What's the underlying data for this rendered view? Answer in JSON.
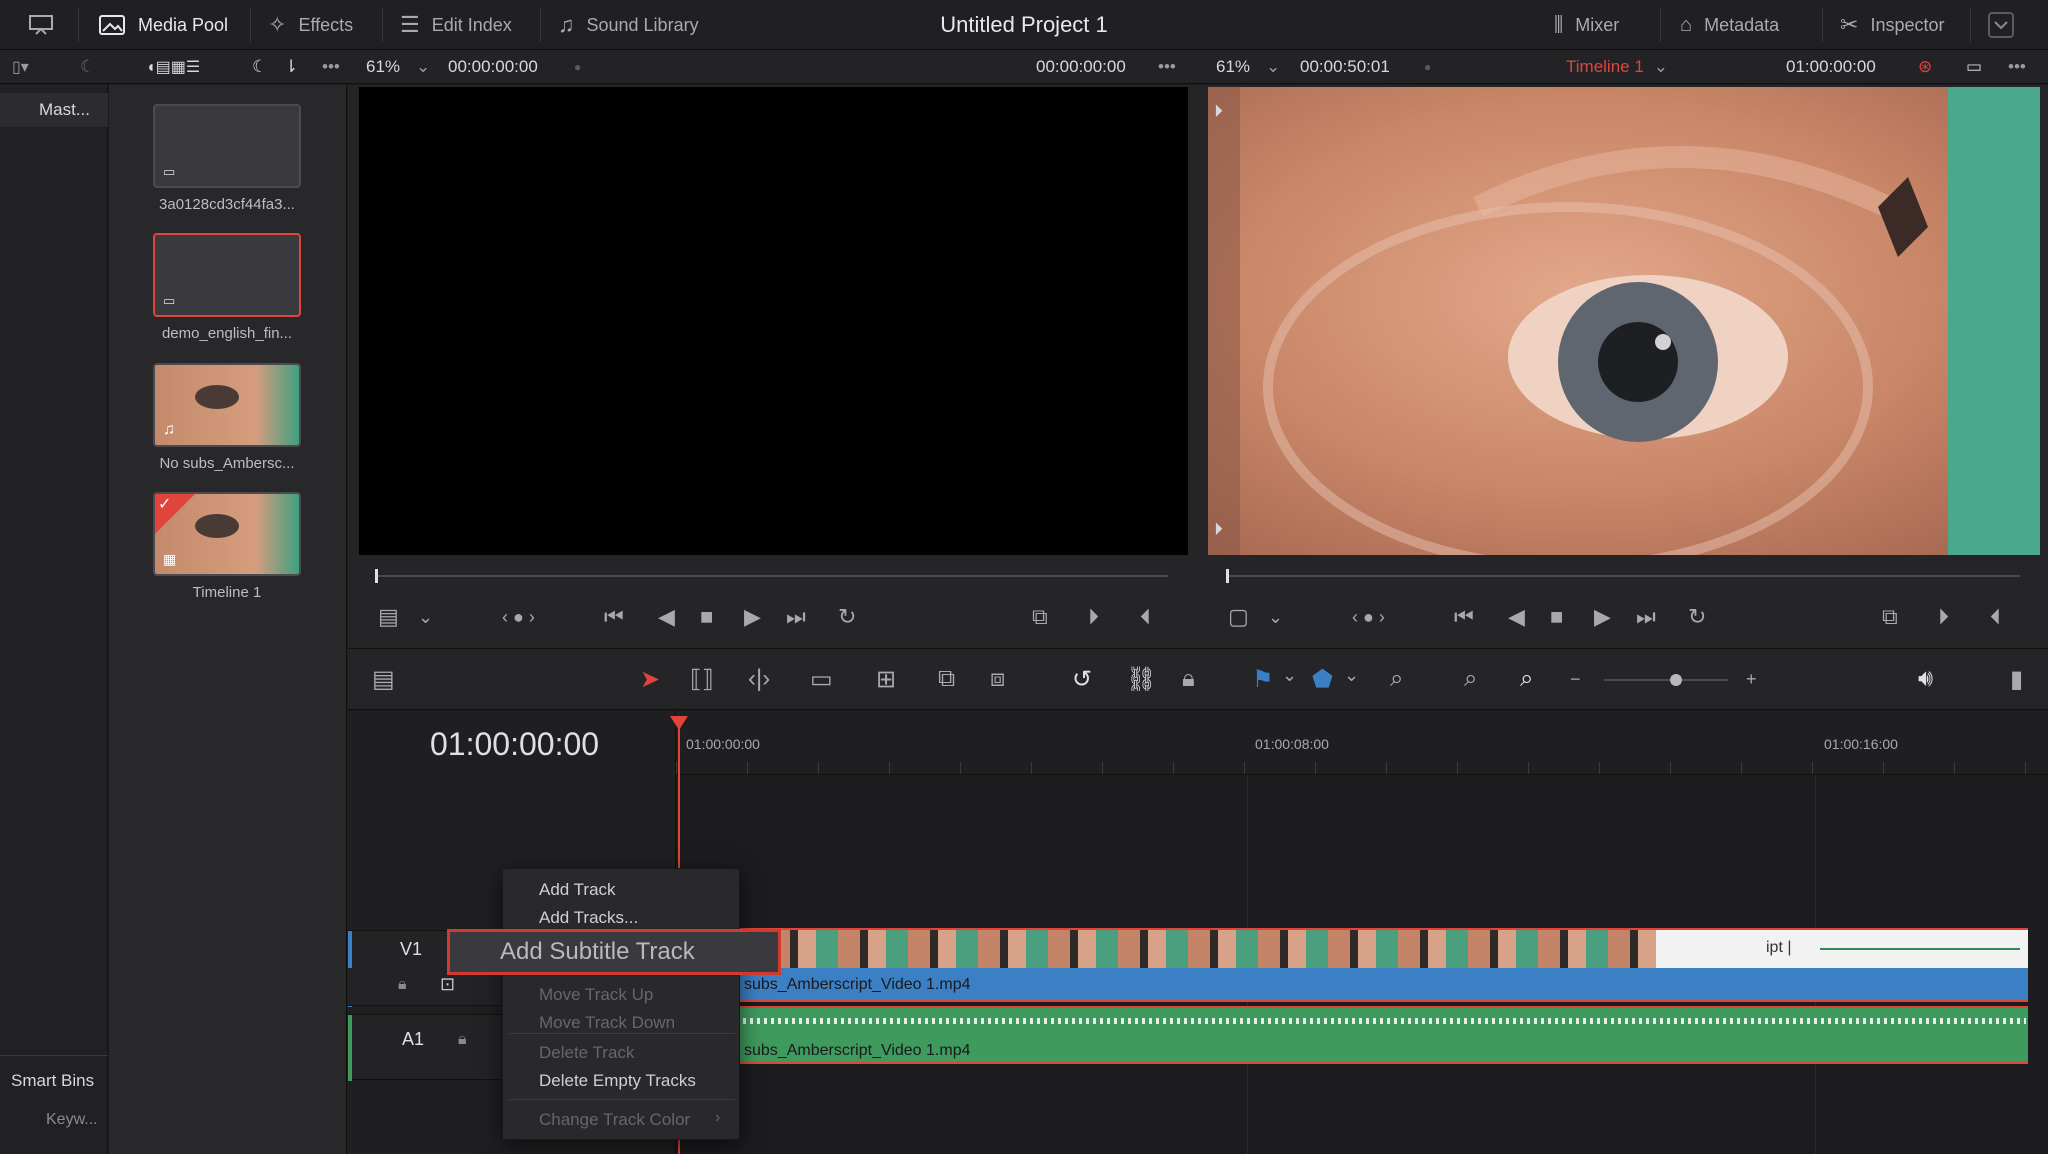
{
  "topbar": {
    "media_pool": "Media Pool",
    "effects": "Effects",
    "edit_index": "Edit Index",
    "sound_library": "Sound Library",
    "project_title": "Untitled Project 1",
    "mixer": "Mixer",
    "metadata": "Metadata",
    "inspector": "Inspector"
  },
  "source_viewer": {
    "zoom": "61%",
    "timecode_left": "00:00:00:00",
    "timecode_right": "00:00:00:00"
  },
  "timeline_viewer": {
    "zoom": "61%",
    "duration": "00:00:50:01",
    "timeline_name": "Timeline 1",
    "timecode": "01:00:00:00"
  },
  "bins": {
    "master": "Mast...",
    "smart_bins": "Smart Bins",
    "keywords": "Keyw..."
  },
  "clips": [
    {
      "label": "3a0128cd3cf44fa3..."
    },
    {
      "label": "demo_english_fin..."
    },
    {
      "label": "No subs_Ambersc..."
    },
    {
      "label": "Timeline 1"
    }
  ],
  "timeline": {
    "current_tc": "01:00:00:00",
    "ruler": [
      "01:00:00:00",
      "01:00:08:00",
      "01:00:16:00"
    ],
    "v1": "V1",
    "a1": "A1",
    "video_clip_name": "subs_Amberscript_Video 1.mp4",
    "audio_clip_name": "subs_Amberscript_Video 1.mp4",
    "clip_fragment": "ipt |"
  },
  "context_menu": {
    "add_track": "Add Track",
    "add_tracks": "Add Tracks...",
    "add_subtitle_track": "Add Subtitle Track",
    "move_up": "Move Track Up",
    "move_down": "Move Track Down",
    "delete_track": "Delete Track",
    "delete_empty": "Delete Empty Tracks",
    "change_color": "Change Track Color"
  },
  "colors": {
    "accent_red": "#e0443b",
    "video_track_blue": "#3b7fc4",
    "audio_track_green": "#3f9a5e",
    "playhead": "#e0443b"
  }
}
